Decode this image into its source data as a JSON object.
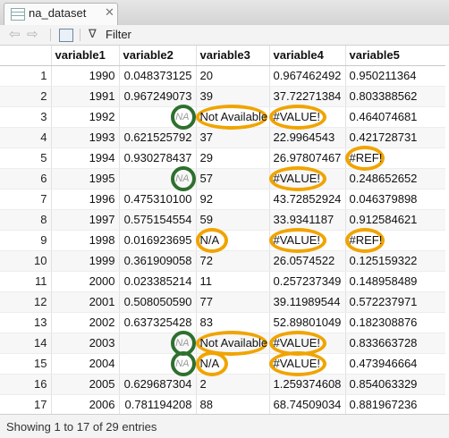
{
  "tab": {
    "label": "na_dataset",
    "close": "✕"
  },
  "toolbar": {
    "filter_label": "Filter"
  },
  "columns": [
    "",
    "variable1",
    "variable2",
    "variable3",
    "variable4",
    "variable5"
  ],
  "rows": [
    [
      "1",
      "1990",
      "0.048373125",
      "20",
      "0.967462492",
      "0.950211364"
    ],
    [
      "2",
      "1991",
      "0.967249073",
      "39",
      "37.72271384",
      "0.803388562"
    ],
    [
      "3",
      "1992",
      "NA",
      "Not Available",
      "#VALUE!",
      "0.464074681"
    ],
    [
      "4",
      "1993",
      "0.621525792",
      "37",
      "22.9964543",
      "0.421728731"
    ],
    [
      "5",
      "1994",
      "0.930278437",
      "29",
      "26.97807467",
      "#REF!"
    ],
    [
      "6",
      "1995",
      "NA",
      "57",
      "#VALUE!",
      "0.248652652"
    ],
    [
      "7",
      "1996",
      "0.475310100",
      "92",
      "43.72852924",
      "0.046379898"
    ],
    [
      "8",
      "1997",
      "0.575154554",
      "59",
      "33.9341187",
      "0.912584621"
    ],
    [
      "9",
      "1998",
      "0.016923695",
      "N/A",
      "#VALUE!",
      "#REF!"
    ],
    [
      "10",
      "1999",
      "0.361909058",
      "72",
      "26.0574522",
      "0.125159322"
    ],
    [
      "11",
      "2000",
      "0.023385214",
      "11",
      "0.257237349",
      "0.148958489"
    ],
    [
      "12",
      "2001",
      "0.508050590",
      "77",
      "39.11989544",
      "0.572237971"
    ],
    [
      "13",
      "2002",
      "0.637325428",
      "83",
      "52.89801049",
      "0.182308876"
    ],
    [
      "14",
      "2003",
      "NA",
      "Not Available",
      "#VALUE!",
      "0.833663728"
    ],
    [
      "15",
      "2004",
      "NA",
      "N/A",
      "#VALUE!",
      "0.473946664"
    ],
    [
      "16",
      "2005",
      "0.629687304",
      "2",
      "1.259374608",
      "0.854063329"
    ],
    [
      "17",
      "2006",
      "0.781194208",
      "88",
      "68.74509034",
      "0.881967236"
    ]
  ],
  "status": {
    "text": "Showing 1 to 17 of 29 entries"
  },
  "colors": {
    "na_ring": "#2f6f2f",
    "error_ring": "#f0a400"
  }
}
